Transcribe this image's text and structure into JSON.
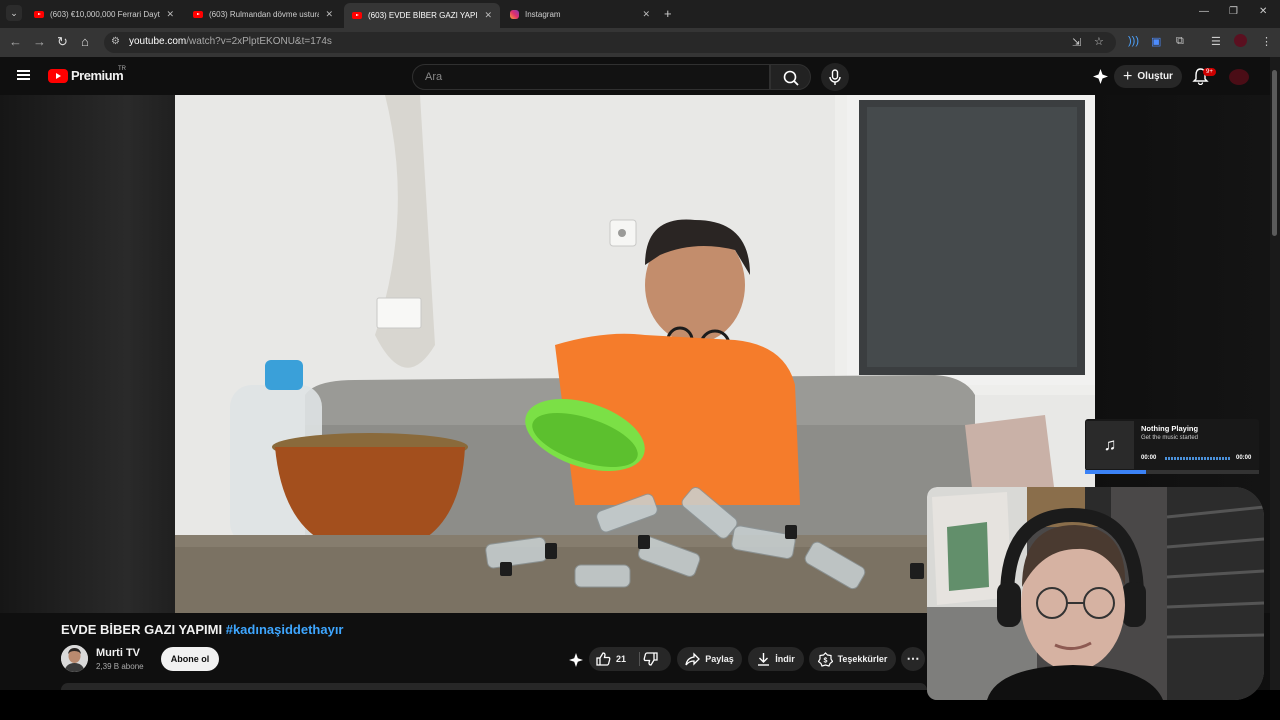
{
  "browser": {
    "tabs": [
      {
        "title": "(603) €10,000,000 Ferrari Dayto",
        "icon": "youtube-icon",
        "active": false
      },
      {
        "title": "(603) Rulmandan dövme ustura",
        "icon": "youtube-icon",
        "active": false
      },
      {
        "title": "(603) EVDE BİBER GAZI YAPIMI",
        "icon": "youtube-icon",
        "active": true
      },
      {
        "title": "Instagram",
        "icon": "instagram-icon",
        "active": false
      }
    ],
    "url_host": "youtube.com",
    "url_path": "/watch?v=2xPlptEKONU&t=174s"
  },
  "youtube": {
    "logo_text": "Premium",
    "country_code": "TR",
    "search_placeholder": "Ara",
    "create_label": "Oluştur",
    "notification_count": "9+",
    "video": {
      "title": "EVDE BİBER GAZI YAPIMI",
      "hashtag": "#kadınaşiddethayır",
      "channel_name": "Murti TV",
      "subscribers": "2,39 B abone",
      "subscribe_label": "Abone ol",
      "like_count": "21",
      "share_label": "Paylaş",
      "download_label": "İndir",
      "thanks_label": "Teşekkürler"
    }
  },
  "now_playing": {
    "title": "Nothing Playing",
    "subtitle": "Get the music started",
    "time_start": "00:00",
    "time_end": "00:00",
    "progress": 0.35
  },
  "colors": {
    "accent_red": "#ff0000",
    "link_blue": "#3ea6ff",
    "shirt_orange": "#f57c2b",
    "bowl_green": "#7be046"
  }
}
